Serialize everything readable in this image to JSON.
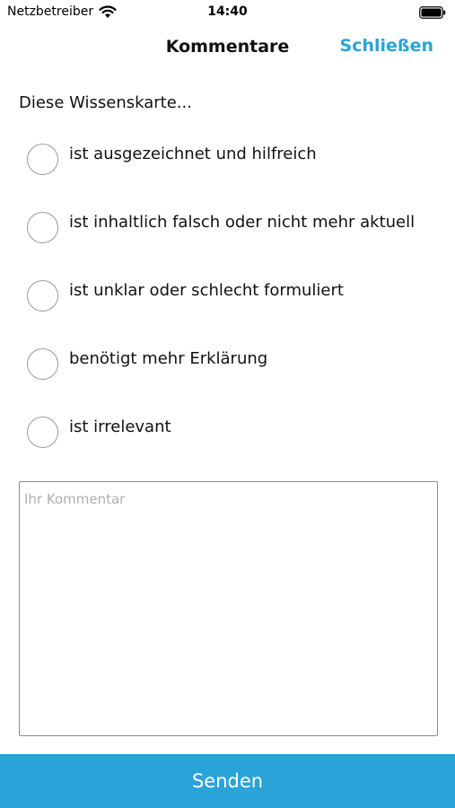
{
  "status_bar": {
    "carrier": "Netzbetreiber",
    "time": "14:40"
  },
  "nav": {
    "title": "Kommentare",
    "close_label": "Schließen"
  },
  "question": "Diese Wissenskarte...",
  "options": [
    {
      "label": "ist ausgezeichnet und hilfreich",
      "selected": false
    },
    {
      "label": "ist inhaltlich falsch oder nicht mehr aktuell",
      "selected": false
    },
    {
      "label": "ist unklar oder schlecht formuliert",
      "selected": false
    },
    {
      "label": "benötigt mehr Erklärung",
      "selected": false
    },
    {
      "label": "ist irrelevant",
      "selected": false
    }
  ],
  "comment": {
    "value": "",
    "placeholder": "Ihr Kommentar"
  },
  "send_label": "Senden",
  "colors": {
    "accent": "#2aa3d9",
    "radio_border": "#9a9a9a",
    "text": "#111111"
  },
  "icons": [
    "wifi-icon",
    "battery-icon"
  ]
}
